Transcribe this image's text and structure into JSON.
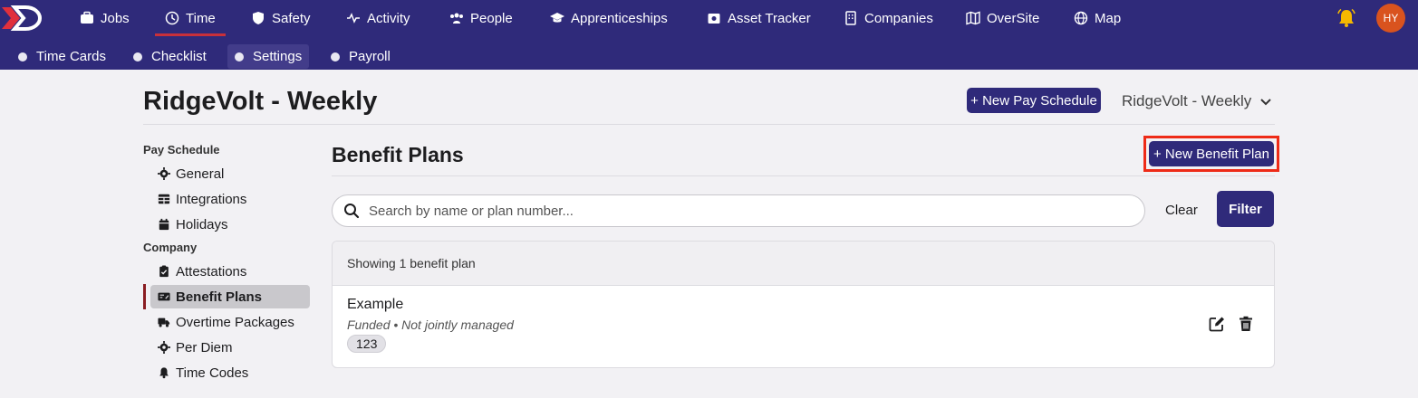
{
  "topnav": {
    "items": [
      {
        "label": "Jobs",
        "icon": "briefcase-icon"
      },
      {
        "label": "Time",
        "icon": "clock-icon"
      },
      {
        "label": "Safety",
        "icon": "shield-icon"
      },
      {
        "label": "Activity",
        "icon": "pulse-icon"
      },
      {
        "label": "People",
        "icon": "people-icon"
      },
      {
        "label": "Apprenticeships",
        "icon": "graduation-cap-icon"
      },
      {
        "label": "Asset Tracker",
        "icon": "asset-icon"
      },
      {
        "label": "Companies",
        "icon": "building-icon"
      },
      {
        "label": "OverSite",
        "icon": "map-fold-icon"
      },
      {
        "label": "Map",
        "icon": "globe-icon"
      }
    ],
    "active": "Time",
    "avatar_initials": "HY"
  },
  "subnav": {
    "items": [
      {
        "label": "Time Cards"
      },
      {
        "label": "Checklist"
      },
      {
        "label": "Settings"
      },
      {
        "label": "Payroll"
      }
    ],
    "active": "Settings"
  },
  "header": {
    "title": "RidgeVolt - Weekly",
    "new_schedule_label": "+ New Pay Schedule",
    "schedule_selected": "RidgeVolt - Weekly"
  },
  "sidebar": {
    "sections": [
      {
        "title": "Pay Schedule",
        "items": [
          {
            "label": "General",
            "icon": "gear-icon"
          },
          {
            "label": "Integrations",
            "icon": "table-icon"
          },
          {
            "label": "Holidays",
            "icon": "calendar-icon"
          }
        ]
      },
      {
        "title": "Company",
        "items": [
          {
            "label": "Attestations",
            "icon": "clipboard-check-icon"
          },
          {
            "label": "Benefit Plans",
            "icon": "money-check-icon"
          },
          {
            "label": "Overtime Packages",
            "icon": "truck-clock-icon"
          },
          {
            "label": "Per Diem",
            "icon": "gear-icon"
          },
          {
            "label": "Time Codes",
            "icon": "bell-icon"
          }
        ]
      }
    ],
    "active": "Benefit Plans"
  },
  "main": {
    "title": "Benefit Plans",
    "new_plan_label": "+ New Benefit Plan",
    "search_placeholder": "Search by name or plan number...",
    "search_value": "",
    "clear_label": "Clear",
    "filter_label": "Filter",
    "results_summary": "Showing 1 benefit plan",
    "plans": [
      {
        "name": "Example",
        "meta": "Funded • Not jointly managed",
        "number": "123"
      }
    ]
  },
  "colors": {
    "nav_bg": "#2f2a7a",
    "accent_red": "#c8303a",
    "highlight": "#ee2b17",
    "avatar": "#d9531e"
  }
}
